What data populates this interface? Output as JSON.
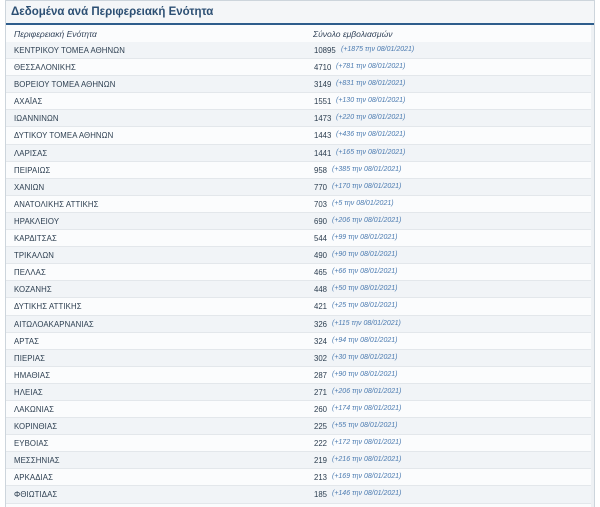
{
  "panel": {
    "title": "Δεδομένα ανά Περιφερειακή Ενότητα",
    "columns": {
      "region": "Περιφερειακή Ενότητα",
      "total": "Σύνολο εμβολιασμών"
    }
  },
  "rows": [
    {
      "region": "ΚΕΝΤΡΙΚΟΥ ΤΟΜΕΑ ΑΘΗΝΩΝ",
      "total": "10895",
      "delta": "(+1875 την 08/01/2021)"
    },
    {
      "region": "ΘΕΣΣΑΛΟΝΙΚΗΣ",
      "total": "4710",
      "delta": "(+781 την 08/01/2021)"
    },
    {
      "region": "ΒΟΡΕΙΟΥ ΤΟΜΕΑ ΑΘΗΝΩΝ",
      "total": "3149",
      "delta": "(+831 την 08/01/2021)"
    },
    {
      "region": "ΑΧΑΪΑΣ",
      "total": "1551",
      "delta": "(+130 την 08/01/2021)"
    },
    {
      "region": "ΙΩΑΝΝΙΝΩΝ",
      "total": "1473",
      "delta": "(+220 την 08/01/2021)"
    },
    {
      "region": "ΔΥΤΙΚΟΥ ΤΟΜΕΑ ΑΘΗΝΩΝ",
      "total": "1443",
      "delta": "(+436 την 08/01/2021)"
    },
    {
      "region": "ΛΑΡΙΣΑΣ",
      "total": "1441",
      "delta": "(+165 την 08/01/2021)"
    },
    {
      "region": "ΠΕΙΡΑΙΩΣ",
      "total": "958",
      "delta": "(+385 την 08/01/2021)"
    },
    {
      "region": "ΧΑΝΙΩΝ",
      "total": "770",
      "delta": "(+170 την 08/01/2021)"
    },
    {
      "region": "ΑΝΑΤΟΛΙΚΗΣ ΑΤΤΙΚΗΣ",
      "total": "703",
      "delta": "(+5 την 08/01/2021)"
    },
    {
      "region": "ΗΡΑΚΛΕΙΟΥ",
      "total": "690",
      "delta": "(+206 την 08/01/2021)"
    },
    {
      "region": "ΚΑΡΔΙΤΣΑΣ",
      "total": "544",
      "delta": "(+99 την 08/01/2021)"
    },
    {
      "region": "ΤΡΙΚΑΛΩΝ",
      "total": "490",
      "delta": "(+90 την 08/01/2021)"
    },
    {
      "region": "ΠΕΛΛΑΣ",
      "total": "465",
      "delta": "(+66 την 08/01/2021)"
    },
    {
      "region": "ΚΟΖΑΝΗΣ",
      "total": "448",
      "delta": "(+50 την 08/01/2021)"
    },
    {
      "region": "ΔΥΤΙΚΗΣ ΑΤΤΙΚΗΣ",
      "total": "421",
      "delta": "(+25 την 08/01/2021)"
    },
    {
      "region": "ΑΙΤΩΛΟΑΚΑΡΝΑΝΙΑΣ",
      "total": "326",
      "delta": "(+115 την 08/01/2021)"
    },
    {
      "region": "ΑΡΤΑΣ",
      "total": "324",
      "delta": "(+94 την 08/01/2021)"
    },
    {
      "region": "ΠΙΕΡΙΑΣ",
      "total": "302",
      "delta": "(+30 την 08/01/2021)"
    },
    {
      "region": "ΗΜΑΘΙΑΣ",
      "total": "287",
      "delta": "(+90 την 08/01/2021)"
    },
    {
      "region": "ΗΛΕΙΑΣ",
      "total": "271",
      "delta": "(+206 την 08/01/2021)"
    },
    {
      "region": "ΛΑΚΩΝΙΑΣ",
      "total": "260",
      "delta": "(+174 την 08/01/2021)"
    },
    {
      "region": "ΚΟΡΙΝΘΙΑΣ",
      "total": "225",
      "delta": "(+55 την 08/01/2021)"
    },
    {
      "region": "ΕΥΒΟΙΑΣ",
      "total": "222",
      "delta": "(+172 την 08/01/2021)"
    },
    {
      "region": "ΜΕΣΣΗΝΙΑΣ",
      "total": "219",
      "delta": "(+216 την 08/01/2021)"
    },
    {
      "region": "ΑΡΚΑΔΙΑΣ",
      "total": "213",
      "delta": "(+169 την 08/01/2021)"
    },
    {
      "region": "ΦΘΙΩΤΙΔΑΣ",
      "total": "185",
      "delta": "(+146 την 08/01/2021)"
    }
  ]
}
